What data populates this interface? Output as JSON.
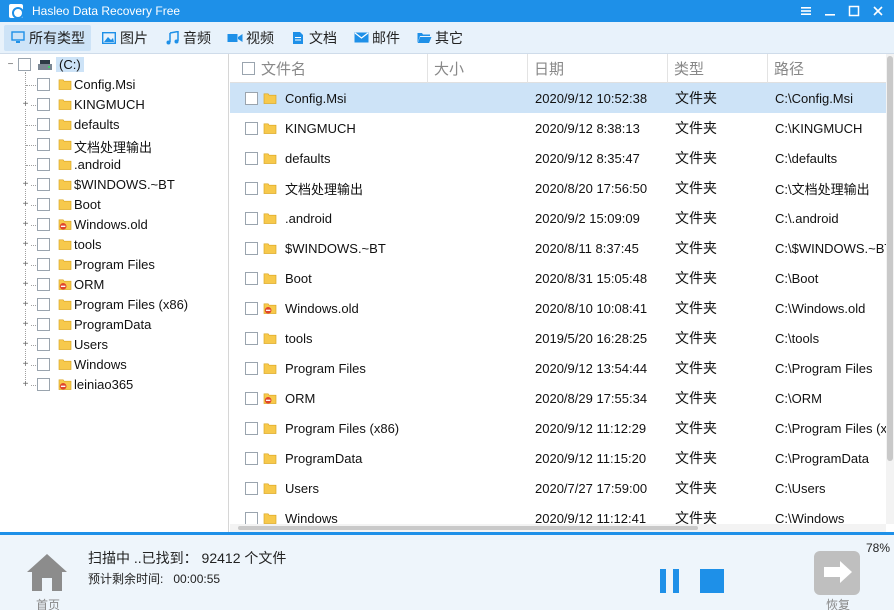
{
  "app": {
    "title": "Hasleo Data Recovery Free"
  },
  "categories": [
    {
      "label": "所有类型",
      "icon": "monitor-icon",
      "active": true
    },
    {
      "label": "图片",
      "icon": "image-icon",
      "active": false
    },
    {
      "label": "音频",
      "icon": "music-note-icon",
      "active": false
    },
    {
      "label": "视频",
      "icon": "video-camera-icon",
      "active": false
    },
    {
      "label": "文档",
      "icon": "document-icon",
      "active": false
    },
    {
      "label": "邮件",
      "icon": "envelope-icon",
      "active": false
    },
    {
      "label": "其它",
      "icon": "folder-open-icon",
      "active": false
    }
  ],
  "tree": {
    "drive": "(C:)",
    "items": [
      {
        "label": "Config.Msi",
        "expandable": false,
        "restricted": false
      },
      {
        "label": "KINGMUCH",
        "expandable": true,
        "restricted": false
      },
      {
        "label": "defaults",
        "expandable": false,
        "restricted": false
      },
      {
        "label": "文档处理输出",
        "expandable": false,
        "restricted": false
      },
      {
        "label": ".android",
        "expandable": false,
        "restricted": false
      },
      {
        "label": "$WINDOWS.~BT",
        "expandable": true,
        "restricted": false
      },
      {
        "label": "Boot",
        "expandable": true,
        "restricted": false
      },
      {
        "label": "Windows.old",
        "expandable": true,
        "restricted": true
      },
      {
        "label": "tools",
        "expandable": true,
        "restricted": false
      },
      {
        "label": "Program Files",
        "expandable": true,
        "restricted": false
      },
      {
        "label": "ORM",
        "expandable": true,
        "restricted": true
      },
      {
        "label": "Program Files (x86)",
        "expandable": true,
        "restricted": false
      },
      {
        "label": "ProgramData",
        "expandable": true,
        "restricted": false
      },
      {
        "label": "Users",
        "expandable": true,
        "restricted": false
      },
      {
        "label": "Windows",
        "expandable": true,
        "restricted": false
      },
      {
        "label": "leiniao365",
        "expandable": true,
        "restricted": true
      }
    ]
  },
  "table": {
    "columns": {
      "name": "文件名",
      "size": "大小",
      "date": "日期",
      "type": "类型",
      "path": "路径"
    },
    "rows": [
      {
        "name": "Config.Msi",
        "size": "",
        "date": "2020/9/12 10:52:38",
        "type": "文件夹",
        "path": "C:\\Config.Msi",
        "restricted": false,
        "selected": true
      },
      {
        "name": "KINGMUCH",
        "size": "",
        "date": "2020/9/12 8:38:13",
        "type": "文件夹",
        "path": "C:\\KINGMUCH",
        "restricted": false,
        "selected": false
      },
      {
        "name": "defaults",
        "size": "",
        "date": "2020/9/12 8:35:47",
        "type": "文件夹",
        "path": "C:\\defaults",
        "restricted": false,
        "selected": false
      },
      {
        "name": "文档处理输出",
        "size": "",
        "date": "2020/8/20 17:56:50",
        "type": "文件夹",
        "path": "C:\\文档处理输出",
        "restricted": false,
        "selected": false
      },
      {
        "name": ".android",
        "size": "",
        "date": "2020/9/2 15:09:09",
        "type": "文件夹",
        "path": "C:\\.android",
        "restricted": false,
        "selected": false
      },
      {
        "name": "$WINDOWS.~BT",
        "size": "",
        "date": "2020/8/11 8:37:45",
        "type": "文件夹",
        "path": "C:\\$WINDOWS.~BT",
        "restricted": false,
        "selected": false
      },
      {
        "name": "Boot",
        "size": "",
        "date": "2020/8/31 15:05:48",
        "type": "文件夹",
        "path": "C:\\Boot",
        "restricted": false,
        "selected": false
      },
      {
        "name": "Windows.old",
        "size": "",
        "date": "2020/8/10 10:08:41",
        "type": "文件夹",
        "path": "C:\\Windows.old",
        "restricted": true,
        "selected": false
      },
      {
        "name": "tools",
        "size": "",
        "date": "2019/5/20 16:28:25",
        "type": "文件夹",
        "path": "C:\\tools",
        "restricted": false,
        "selected": false
      },
      {
        "name": "Program Files",
        "size": "",
        "date": "2020/9/12 13:54:44",
        "type": "文件夹",
        "path": "C:\\Program Files",
        "restricted": false,
        "selected": false
      },
      {
        "name": "ORM",
        "size": "",
        "date": "2020/8/29 17:55:34",
        "type": "文件夹",
        "path": "C:\\ORM",
        "restricted": true,
        "selected": false
      },
      {
        "name": "Program Files (x86)",
        "size": "",
        "date": "2020/9/12 11:12:29",
        "type": "文件夹",
        "path": "C:\\Program Files (x",
        "restricted": false,
        "selected": false
      },
      {
        "name": "ProgramData",
        "size": "",
        "date": "2020/9/12 11:15:20",
        "type": "文件夹",
        "path": "C:\\ProgramData",
        "restricted": false,
        "selected": false
      },
      {
        "name": "Users",
        "size": "",
        "date": "2020/7/27 17:59:00",
        "type": "文件夹",
        "path": "C:\\Users",
        "restricted": false,
        "selected": false
      },
      {
        "name": "Windows",
        "size": "",
        "date": "2020/9/12 11:12:41",
        "type": "文件夹",
        "path": "C:\\Windows",
        "restricted": false,
        "selected": false
      }
    ]
  },
  "status": {
    "scan_text": "扫描中 ..已找到： 92412 个文件",
    "eta_label": "预计剩余时间:",
    "eta_value": "00:00:55",
    "percent": "78%",
    "progress_fraction": 0.78,
    "home_label": "首页",
    "export_label": "恢复"
  },
  "colors": {
    "accent": "#1e90e8",
    "selection": "#cde3f7",
    "folder": "#f7c94c",
    "restricted": "#e0452b"
  }
}
